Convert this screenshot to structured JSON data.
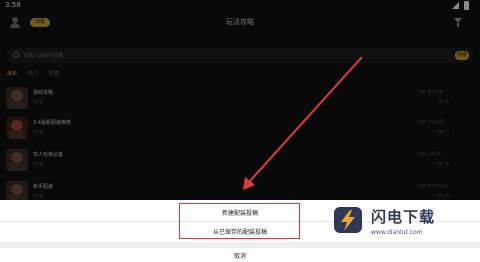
{
  "status_bar": {
    "time": "3:58"
  },
  "header": {
    "badge": "出装",
    "title": "玩法攻略"
  },
  "search": {
    "placeholder": "请输入关键字搜索",
    "button": "搜索"
  },
  "tabs": [
    {
      "label": "最新",
      "active": true
    },
    {
      "label": "热门",
      "active": false
    },
    {
      "label": "收藏",
      "active": false
    }
  ],
  "list": [
    {
      "title": "游戏攻略",
      "subtitle": "0分享",
      "author": "作者 游戏大神",
      "stat": "👁 26"
    },
    {
      "title": "3.4最新配装推荐",
      "subtitle": "0分享",
      "author": "作者 大神玩家",
      "stat": "👁 51"
    },
    {
      "title": "穷人玩家必备",
      "subtitle": "0分享",
      "author": "作者 玩家123",
      "stat": "👁 19"
    },
    {
      "title": "新手配装",
      "subtitle": "0分享",
      "author": "作者 新手指导员",
      "stat": "👁 23"
    }
  ],
  "sheet": {
    "option_new": "新建配装投稿",
    "option_saved": "从已保存的配装投稿",
    "cancel": "取消"
  },
  "watermark": {
    "brand": "闪电下载",
    "url": "www.dianlut.com"
  },
  "colors": {
    "accent": "#c9a83e",
    "highlight": "#e03a3a"
  }
}
